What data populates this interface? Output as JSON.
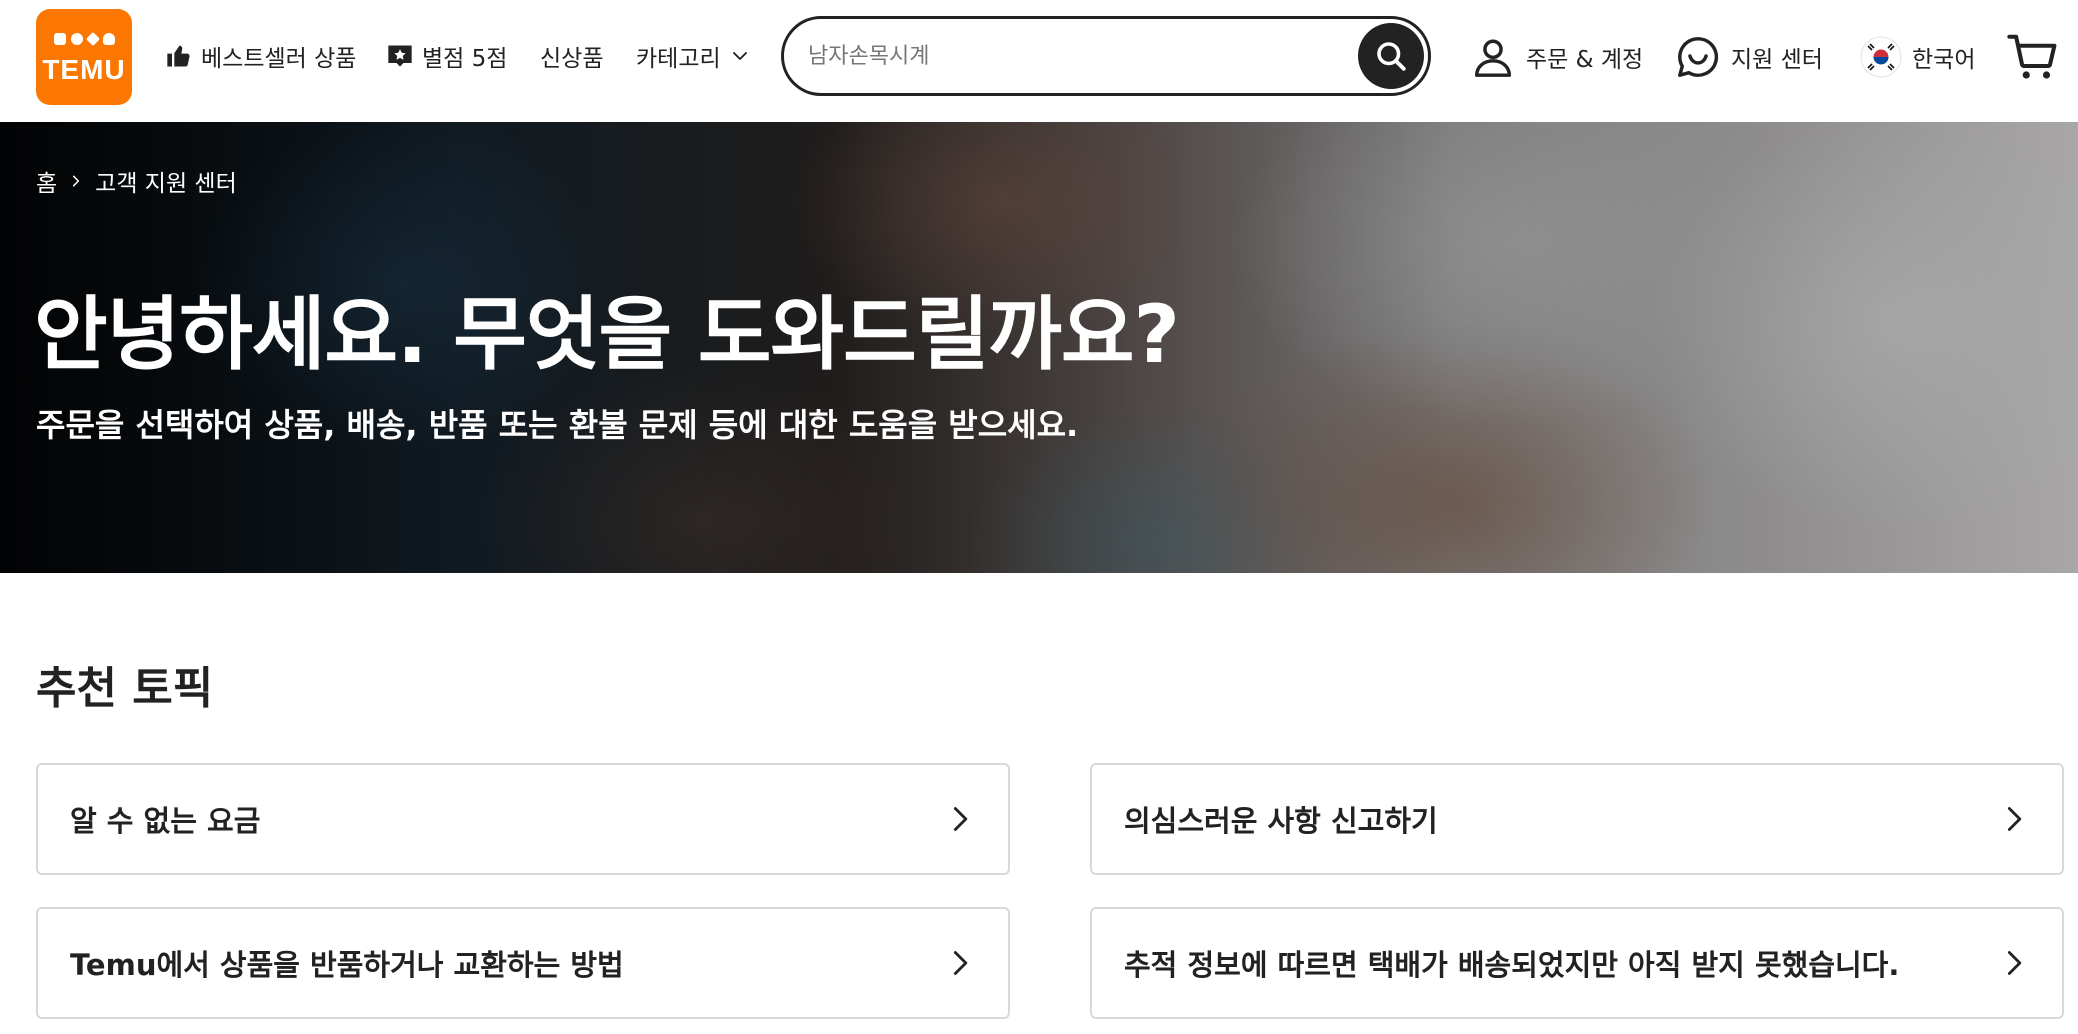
{
  "header": {
    "logo_text": "TEMU",
    "nav": [
      {
        "label": "베스트셀러 상품",
        "icon": "thumbs-up-icon"
      },
      {
        "label": "별점 5점",
        "icon": "star-badge-icon"
      },
      {
        "label": "신상품"
      },
      {
        "label": "카테고리",
        "icon": "chevron-down-icon"
      }
    ],
    "search": {
      "placeholder": "남자손목시계",
      "value": ""
    },
    "orders_account_label": "주문 & 계정",
    "support_label": "지원 센터",
    "language_label": "한국어"
  },
  "hero": {
    "breadcrumb": [
      "홈",
      "고객 지원 센터"
    ],
    "title": "안녕하세요. 무엇을 도와드릴까요?",
    "subtitle": "주문을 선택하여 상품, 배송, 반품 또는 환불 문제 등에 대한 도움을 받으세요."
  },
  "topics": {
    "title": "추천 토픽",
    "items": [
      "알 수 없는 요금",
      "의심스러운 사항 신고하기",
      "Temu에서 상품을 반품하거나 교환하는 방법",
      "추적 정보에 따르면 택배가 배송되었지만 아직 받지 못했습니다."
    ]
  },
  "colors": {
    "brand": "#fb7701",
    "text": "#222222",
    "border": "#d9d9d9"
  }
}
